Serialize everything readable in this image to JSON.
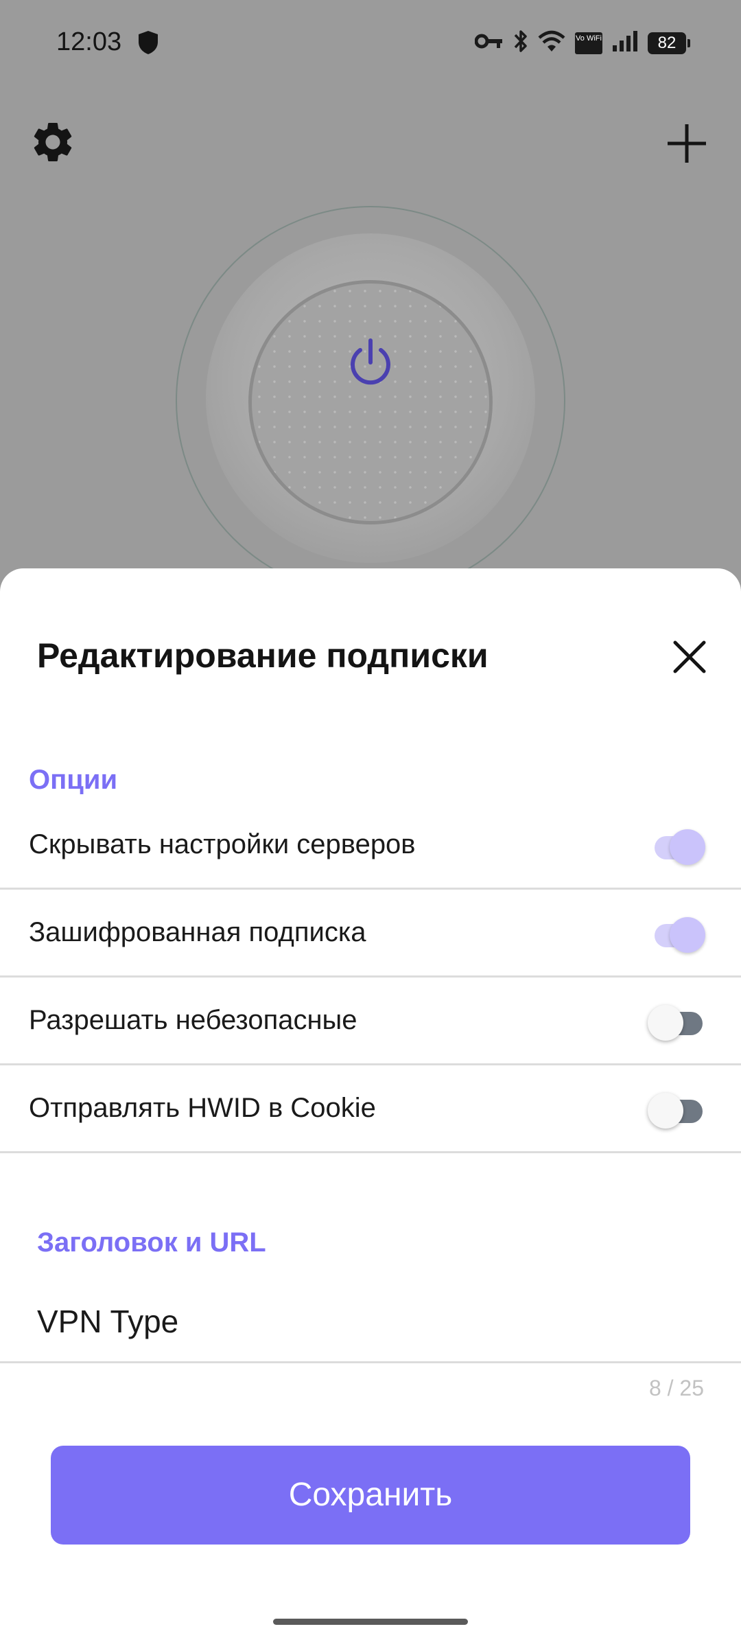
{
  "status_bar": {
    "time": "12:03",
    "volte_text": "Vo WiFi",
    "battery": "82"
  },
  "header": {
    "settings_icon": "gear-icon",
    "add_icon": "plus-icon"
  },
  "connect": {
    "icon": "power-icon",
    "accent_color": "#4a40b0"
  },
  "sheet": {
    "title": "Редактирование подписки",
    "close_icon": "close-icon",
    "options_section": "Опции",
    "options": [
      {
        "label": "Скрывать настройки серверов",
        "enabled": true
      },
      {
        "label": "Зашифрованная подписка",
        "enabled": true
      },
      {
        "label": "Разрешать небезопасные",
        "enabled": false
      },
      {
        "label": "Отправлять HWID в Cookie",
        "enabled": false
      }
    ],
    "title_section": "Заголовок и URL",
    "title_value": "VPN Type",
    "counter": "8 / 25",
    "save_label": "Сохранить",
    "accent_color": "#7b6ff5"
  }
}
